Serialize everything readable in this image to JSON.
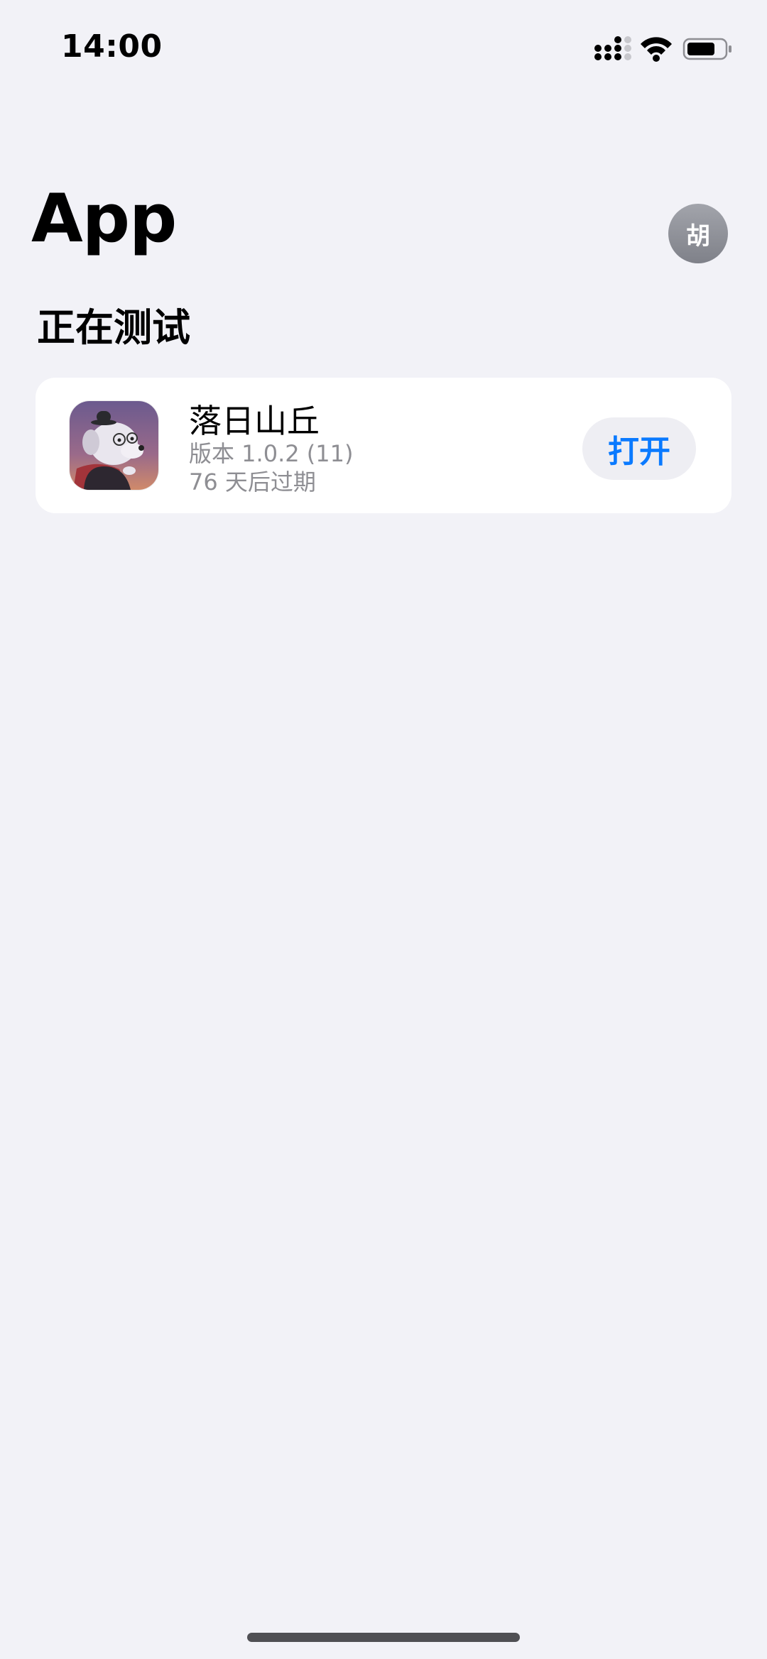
{
  "status_bar": {
    "time": "14:00",
    "icons": [
      "cellular-signal-icon",
      "wifi-icon",
      "battery-icon"
    ]
  },
  "header": {
    "title": "App",
    "avatar_initial": "胡"
  },
  "section": {
    "title": "正在测试"
  },
  "apps": [
    {
      "name": "落日山丘",
      "version": "版本 1.0.2 (11)",
      "expiry": "76 天后过期",
      "action_label": "打开",
      "icon": "app-icon-dog-illustration"
    }
  ],
  "colors": {
    "background": "#f2f2f7",
    "card": "#ffffff",
    "accent": "#0a7aff",
    "secondary_text": "#8e8e93",
    "button_bg": "#eeeef3"
  }
}
